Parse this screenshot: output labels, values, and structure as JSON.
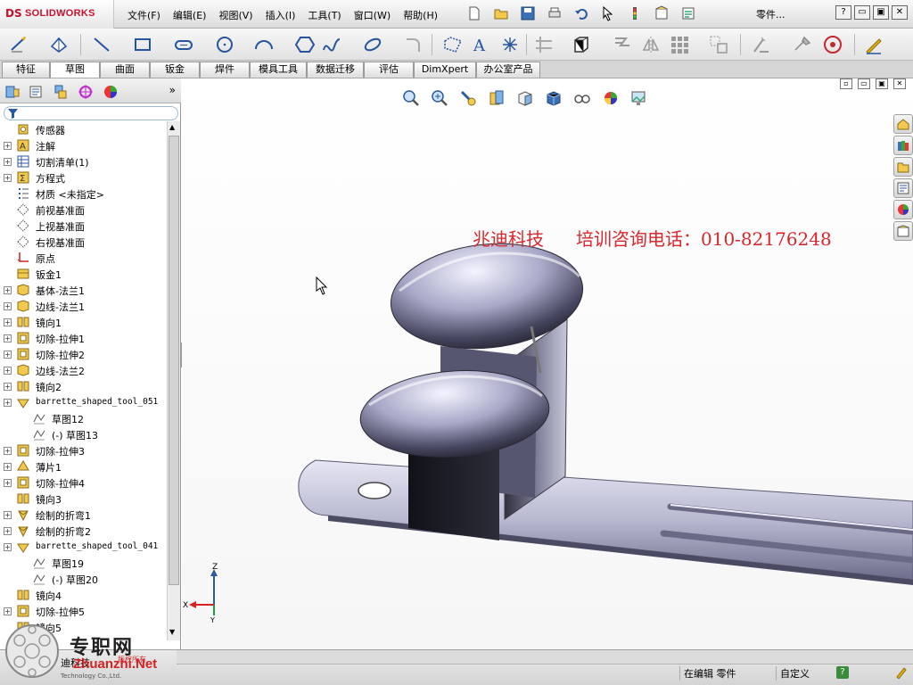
{
  "app": {
    "brand_ds": "DS",
    "brand_name": "SOLIDWORKS",
    "document_label": "零件...",
    "accent_red": "#c8102e"
  },
  "menu": {
    "items": [
      "文件(F)",
      "编辑(E)",
      "视图(V)",
      "插入(I)",
      "工具(T)",
      "窗口(W)",
      "帮助(H)"
    ]
  },
  "window_controls": {
    "help_icon": "question-icon",
    "minimize": "▭",
    "restore": "▣",
    "close": "✕"
  },
  "quick_access": [
    "new-icon",
    "open-icon",
    "save-icon",
    "print-icon",
    "undo-icon",
    "select-icon",
    "rebuild-icon",
    "file-properties-icon",
    "options-icon"
  ],
  "sketch_toolbar": [
    "smart-dimension-icon",
    "sketch-icon",
    "line-icon",
    "rectangle-icon",
    "slot-icon",
    "circle-icon",
    "arc-icon",
    "polygon-icon",
    "spline-icon",
    "ellipse-icon",
    "fillet-icon",
    "plane-icon",
    "text-icon",
    "point-icon",
    "trim-icon",
    "offset-icon",
    "convert-icon",
    "mirror-icon",
    "pattern-icon",
    "move-icon",
    "relations-icon",
    "repair-icon",
    "quick-snaps-icon",
    "instant2d-icon"
  ],
  "tabs": [
    {
      "label": "特征",
      "active": false
    },
    {
      "label": "草图",
      "active": true
    },
    {
      "label": "曲面",
      "active": false
    },
    {
      "label": "钣金",
      "active": false
    },
    {
      "label": "焊件",
      "active": false
    },
    {
      "label": "模具工具",
      "active": false
    },
    {
      "label": "数据迁移",
      "active": false
    },
    {
      "label": "评估",
      "active": false
    },
    {
      "label": "DimXpert",
      "active": false
    },
    {
      "label": "办公室产品",
      "active": false
    }
  ],
  "feature_manager": {
    "panel_tabs": [
      "featuremanager-icon",
      "propertymanager-icon",
      "configurationmanager-icon",
      "dimxpert-icon",
      "display-manager-icon"
    ],
    "expand": "»",
    "filter_icon": "filter-icon",
    "tree": [
      {
        "label": "传感器",
        "icon": "sensor-icon",
        "indent": 0,
        "expandable": false
      },
      {
        "label": "注解",
        "icon": "annotation-icon",
        "indent": 0,
        "expandable": true
      },
      {
        "label": "切割清单(1)",
        "icon": "cutlist-icon",
        "indent": 0,
        "expandable": true
      },
      {
        "label": "方程式",
        "icon": "equation-icon",
        "indent": 0,
        "expandable": true
      },
      {
        "label": "材质 <未指定>",
        "icon": "material-icon",
        "indent": 0,
        "expandable": false
      },
      {
        "label": "前视基准面",
        "icon": "plane-icon",
        "indent": 0,
        "expandable": false
      },
      {
        "label": "上视基准面",
        "icon": "plane-icon",
        "indent": 0,
        "expandable": false
      },
      {
        "label": "右视基准面",
        "icon": "plane-icon",
        "indent": 0,
        "expandable": false
      },
      {
        "label": "原点",
        "icon": "origin-icon",
        "indent": 0,
        "expandable": false
      },
      {
        "label": "钣金1",
        "icon": "sheetmetal-icon",
        "indent": 0,
        "expandable": false
      },
      {
        "label": "基体-法兰1",
        "icon": "feature-icon",
        "indent": 0,
        "expandable": true
      },
      {
        "label": "边线-法兰1",
        "icon": "feature-icon",
        "indent": 0,
        "expandable": true
      },
      {
        "label": "镜向1",
        "icon": "mirror-feature-icon",
        "indent": 0,
        "expandable": true
      },
      {
        "label": "切除-拉伸1",
        "icon": "cut-extrude-icon",
        "indent": 0,
        "expandable": true
      },
      {
        "label": "切除-拉伸2",
        "icon": "cut-extrude-icon",
        "indent": 0,
        "expandable": true
      },
      {
        "label": "边线-法兰2",
        "icon": "feature-icon",
        "indent": 0,
        "expandable": true
      },
      {
        "label": "镜向2",
        "icon": "mirror-feature-icon",
        "indent": 0,
        "expandable": true
      },
      {
        "label": "barrette_shaped_tool_051",
        "icon": "forming-tool-icon",
        "indent": 0,
        "expandable": true,
        "mono": true
      },
      {
        "label": "草图12",
        "icon": "sketch-node-icon",
        "indent": 1,
        "expandable": false
      },
      {
        "label": "(-) 草图13",
        "icon": "sketch-node-icon",
        "indent": 1,
        "expandable": false
      },
      {
        "label": "切除-拉伸3",
        "icon": "cut-extrude-icon",
        "indent": 0,
        "expandable": true
      },
      {
        "label": "薄片1",
        "icon": "tab-feature-icon",
        "indent": 0,
        "expandable": true
      },
      {
        "label": "切除-拉伸4",
        "icon": "cut-extrude-icon",
        "indent": 0,
        "expandable": true
      },
      {
        "label": "镜向3",
        "icon": "mirror-feature-icon",
        "indent": 0,
        "expandable": false
      },
      {
        "label": "绘制的折弯1",
        "icon": "sketched-bend-icon",
        "indent": 0,
        "expandable": true
      },
      {
        "label": "绘制的折弯2",
        "icon": "sketched-bend-icon",
        "indent": 0,
        "expandable": true
      },
      {
        "label": "barrette_shaped_tool_041",
        "icon": "forming-tool-icon",
        "indent": 0,
        "expandable": true,
        "mono": true
      },
      {
        "label": "草图19",
        "icon": "sketch-node-icon",
        "indent": 1,
        "expandable": false
      },
      {
        "label": "(-) 草图20",
        "icon": "sketch-node-icon",
        "indent": 1,
        "expandable": false
      },
      {
        "label": "镜向4",
        "icon": "mirror-feature-icon",
        "indent": 0,
        "expandable": false
      },
      {
        "label": "切除-拉伸5",
        "icon": "cut-extrude-icon",
        "indent": 0,
        "expandable": true
      },
      {
        "label": "镜向5",
        "icon": "mirror-feature-icon",
        "indent": 0,
        "expandable": false
      }
    ]
  },
  "graphics": {
    "heads_up": [
      "zoom-to-fit-icon",
      "zoom-to-area-icon",
      "previous-view-icon",
      "section-view-icon",
      "view-orientation-icon",
      "display-style-icon",
      "hide-show-icon",
      "appearance-icon",
      "scene-icon"
    ],
    "viewport_controls": [
      "▫",
      "▭",
      "▣",
      "✕"
    ],
    "task_pane": [
      "home-icon",
      "design-library-icon",
      "file-explorer-icon",
      "view-palette-icon",
      "appearances-icon",
      "custom-properties-icon"
    ],
    "watermark_company": "兆迪科技",
    "watermark_phone": "培训咨询电话：010-82176248",
    "triad_axes": [
      "X",
      "Y",
      "Z"
    ]
  },
  "status_bar": {
    "left_text": "迪科技",
    "editing": "在编辑 零件",
    "custom": "自定义",
    "help_glyph": "?"
  },
  "site_mark": {
    "big_text": "专职网",
    "url": "Zhuanzhi.Net",
    "tiny_text": "版权所有",
    "tiny_text2": "Technology Co.,Ltd."
  }
}
